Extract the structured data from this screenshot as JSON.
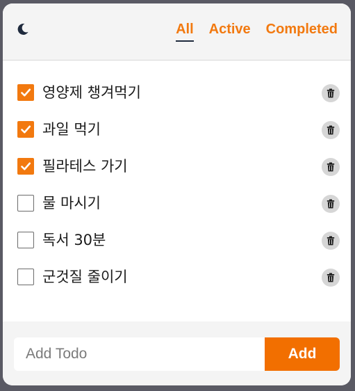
{
  "header": {
    "theme_icon": "moon-icon",
    "filters": [
      {
        "label": "All",
        "active": true
      },
      {
        "label": "Active",
        "active": false
      },
      {
        "label": "Completed",
        "active": false
      }
    ]
  },
  "todos": [
    {
      "text": "영양제 챙겨먹기",
      "completed": true
    },
    {
      "text": "과일 먹기",
      "completed": true
    },
    {
      "text": "필라테스 가기",
      "completed": true
    },
    {
      "text": "물 마시기",
      "completed": false
    },
    {
      "text": "독서 30분",
      "completed": false
    },
    {
      "text": "군것질 줄이기",
      "completed": false
    }
  ],
  "delete_icon": "trash-icon",
  "form": {
    "placeholder": "Add Todo",
    "value": "",
    "add_label": "Add"
  },
  "colors": {
    "accent": "#f2790f",
    "add_button": "#f26f00",
    "header_bg": "#f4f4f4",
    "delete_bg": "#d6d6d6",
    "active_underline": "#1f2a3d"
  }
}
